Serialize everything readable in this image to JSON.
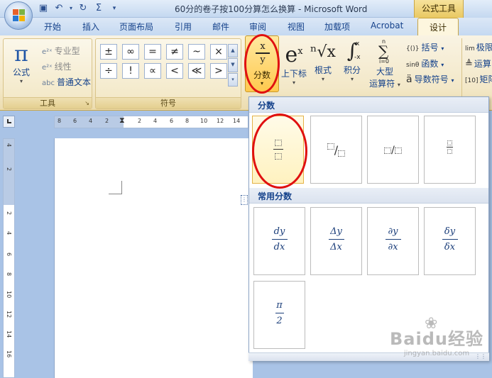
{
  "window": {
    "title": "60分的卷子按100分算怎么换算 - Microsoft Word",
    "context_tab_title": "公式工具"
  },
  "quick_access": [
    "save-icon",
    "undo-icon",
    "redo-icon",
    "sigma-icon",
    "customize-icon"
  ],
  "tabs": [
    {
      "label": "开始"
    },
    {
      "label": "插入"
    },
    {
      "label": "页面布局"
    },
    {
      "label": "引用"
    },
    {
      "label": "邮件"
    },
    {
      "label": "审阅"
    },
    {
      "label": "视图"
    },
    {
      "label": "加载项"
    },
    {
      "label": "Acrobat"
    },
    {
      "label": "设计",
      "active": true
    }
  ],
  "ribbon": {
    "tools_group": {
      "label": "工具",
      "equation_label": "公式",
      "professional_label": "专业型",
      "linear_label": "线性",
      "normal_text_label": "普通文本",
      "normal_text_icon": "abc"
    },
    "symbols_group": {
      "label": "符号",
      "symbols": [
        "±",
        "∞",
        "=",
        "≠",
        "~",
        "×",
        "÷",
        "!",
        "∝",
        "<",
        "≪",
        ">"
      ]
    },
    "structures": {
      "fraction": {
        "label": "分数",
        "num": "x",
        "den": "y"
      },
      "script": {
        "label": "上下标",
        "glyph": "e",
        "sup": "x"
      },
      "radical": {
        "label": "根式",
        "glyph": "ⁿ√x"
      },
      "integral": {
        "label": "积分",
        "glyph": "∫",
        "upper": "x",
        "lower": "-x"
      },
      "large_operator": {
        "label": "大型",
        "label2": "运算符",
        "glyph": "∑",
        "upper": "n",
        "lower": "i=0"
      },
      "bracket": {
        "label": "括号",
        "icon": "{()}"
      },
      "function": {
        "label": "函数",
        "icon": "sinθ"
      },
      "accent": {
        "label": "导数符号",
        "icon": "ä"
      },
      "limit": {
        "label": "极限",
        "icon": "lim"
      },
      "operator": {
        "label": "运算",
        "icon": "≜"
      },
      "matrix": {
        "label": "矩阵",
        "icon": "[10]"
      }
    }
  },
  "ruler": {
    "h_numbers": [
      "8",
      "6",
      "4",
      "2",
      "2",
      "4",
      "6",
      "8",
      "10",
      "12",
      "14"
    ],
    "v_numbers": [
      "4",
      "2",
      "2",
      "4",
      "6",
      "8",
      "10",
      "12",
      "14",
      "16"
    ]
  },
  "gallery": {
    "section1_title": "分数",
    "section2_title": "常用分数",
    "common_fractions": [
      {
        "num": "dy",
        "den": "dx"
      },
      {
        "num": "Δy",
        "den": "Δx"
      },
      {
        "num": "∂y",
        "den": "∂x"
      },
      {
        "num": "δy",
        "den": "δx"
      },
      {
        "num": "π",
        "den": "2"
      }
    ]
  },
  "watermark": {
    "brand": "Baidu经验",
    "url": "jingyan.baidu.com"
  },
  "colors": {
    "annotation": "#e01010",
    "ribbon_accent": "#f3e8c8",
    "selected": "#ffc94e"
  }
}
